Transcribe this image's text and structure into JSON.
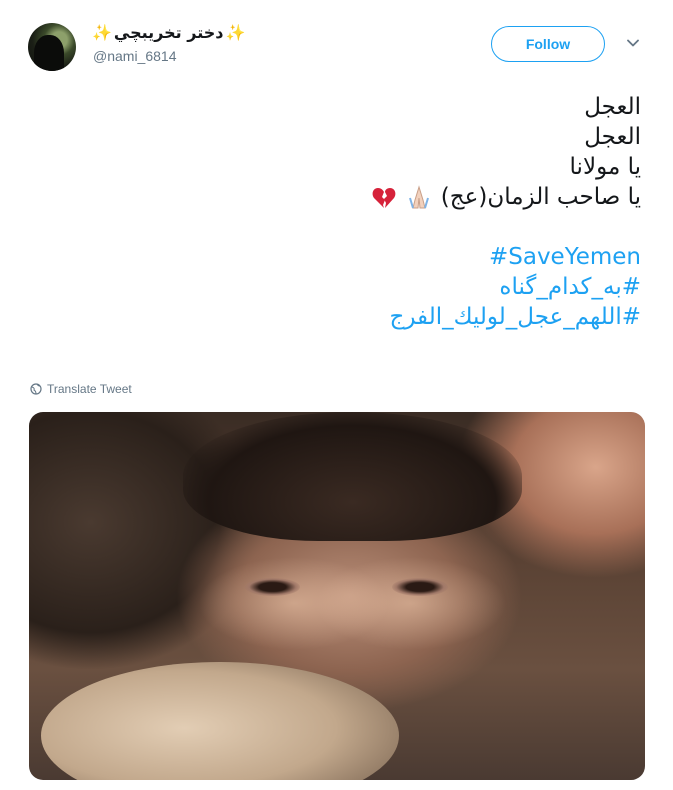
{
  "user": {
    "display_name": "دختر تخریبچي",
    "sparkle_left": "✨",
    "sparkle_right": "✨",
    "handle": "@nami_6814"
  },
  "actions": {
    "follow_label": "Follow"
  },
  "tweet": {
    "lines": [
      "العجل",
      "العجل",
      "يا مولانا",
      "يا صاحب الزمان(عج)"
    ],
    "emojis": [
      "praying-hands",
      "broken-heart"
    ],
    "hashtags": [
      "#SaveYemen",
      "#به_کدام_گناه",
      "#اللهم_عجل_لولیك_الفرج"
    ],
    "translate_label": "Translate Tweet"
  },
  "colors": {
    "link": "#1da1f2",
    "text": "#14171a",
    "muted": "#657786"
  }
}
